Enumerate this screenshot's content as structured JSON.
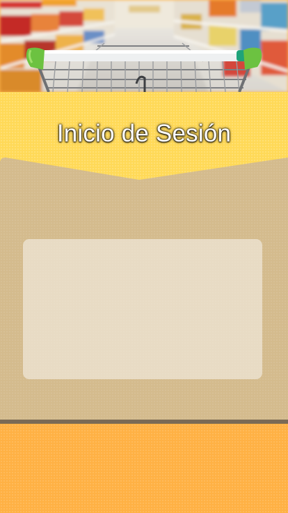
{
  "header": {
    "title": "Inicio de Sesión",
    "image": "supermarket-cart-photo"
  },
  "login_card": {
    "form_panel": "empty"
  },
  "colors": {
    "title_band": "#ffd957",
    "card": "#d4bb8d",
    "card_shadow": "#7a6a55",
    "bottom": "#ffb144",
    "cart_handle": "#6cc241",
    "title_text": "#ffffff"
  }
}
